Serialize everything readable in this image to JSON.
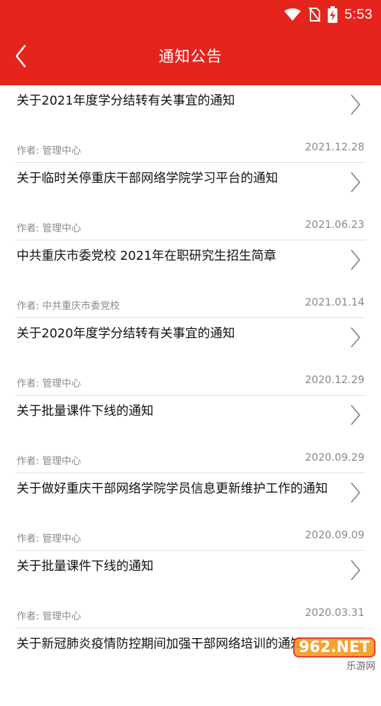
{
  "status_bar": {
    "time": "5:53"
  },
  "header": {
    "title": "通知公告"
  },
  "items": [
    {
      "title": "关于2021年度学分结转有关事宜的通知",
      "author": "作者: 管理中心",
      "date": "2021.12.28"
    },
    {
      "title": "关于临时关停重庆干部网络学院学习平台的通知",
      "author": "作者: 管理中心",
      "date": "2021.06.23"
    },
    {
      "title": "中共重庆市委党校 2021年在职研究生招生简章",
      "author": "作者: 中共重庆市委党校",
      "date": "2021.01.14"
    },
    {
      "title": "关于2020年度学分结转有关事宜的通知",
      "author": "作者: 管理中心",
      "date": "2020.12.29"
    },
    {
      "title": "关于批量课件下线的通知",
      "author": "作者: 管理中心",
      "date": "2020.09.29"
    },
    {
      "title": "关于做好重庆干部网络学院学员信息更新维护工作的通知",
      "author": "作者: 管理中心",
      "date": "2020.09.09"
    },
    {
      "title": "关于批量课件下线的通知",
      "author": "作者: 管理中心",
      "date": "2020.03.31"
    },
    {
      "title": "关于新冠肺炎疫情防控期间加强干部网络培训的通知",
      "author": "",
      "date": ""
    }
  ],
  "watermark": {
    "brand": "962.NET",
    "sub": "乐游网"
  },
  "colors": {
    "header_bg": "#e6241e",
    "text": "#111111",
    "muted": "#8a8a8a"
  }
}
